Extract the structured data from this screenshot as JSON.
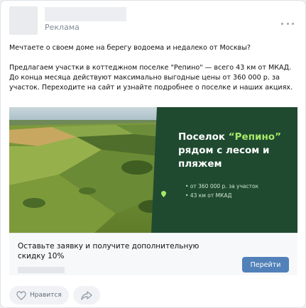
{
  "post": {
    "ad_label": "Реклама",
    "paragraphs": [
      "Мечтаете о своем доме на берегу водоема и недалеко от Москвы?",
      "Предлагаем участки в коттеджном поселке \"Репино\" — всего 43 км от МКАД. До конца месяца действуют максимально выгодные цены от 360 000 р. за участок. Переходите на сайт и узнайте подробнее о поселке и наших акциях."
    ]
  },
  "banner": {
    "title_prefix": "Поселок ",
    "title_highlight": "“Репино”",
    "title_rest": "рядом с лесом и пляжем",
    "bullets": [
      "от 360 000 р. за участок",
      "43 км от МКАД"
    ],
    "accent_color": "#a6e86a",
    "panel_color": "#1f4a30"
  },
  "cta": {
    "text": "Оставьте заявку и получите дополнительную скидку 10%",
    "button_label": "Перейти",
    "button_color": "#5181b8"
  },
  "actions": {
    "like_label": "Нравится",
    "like_icon": "heart-icon",
    "share_icon": "share-icon"
  }
}
